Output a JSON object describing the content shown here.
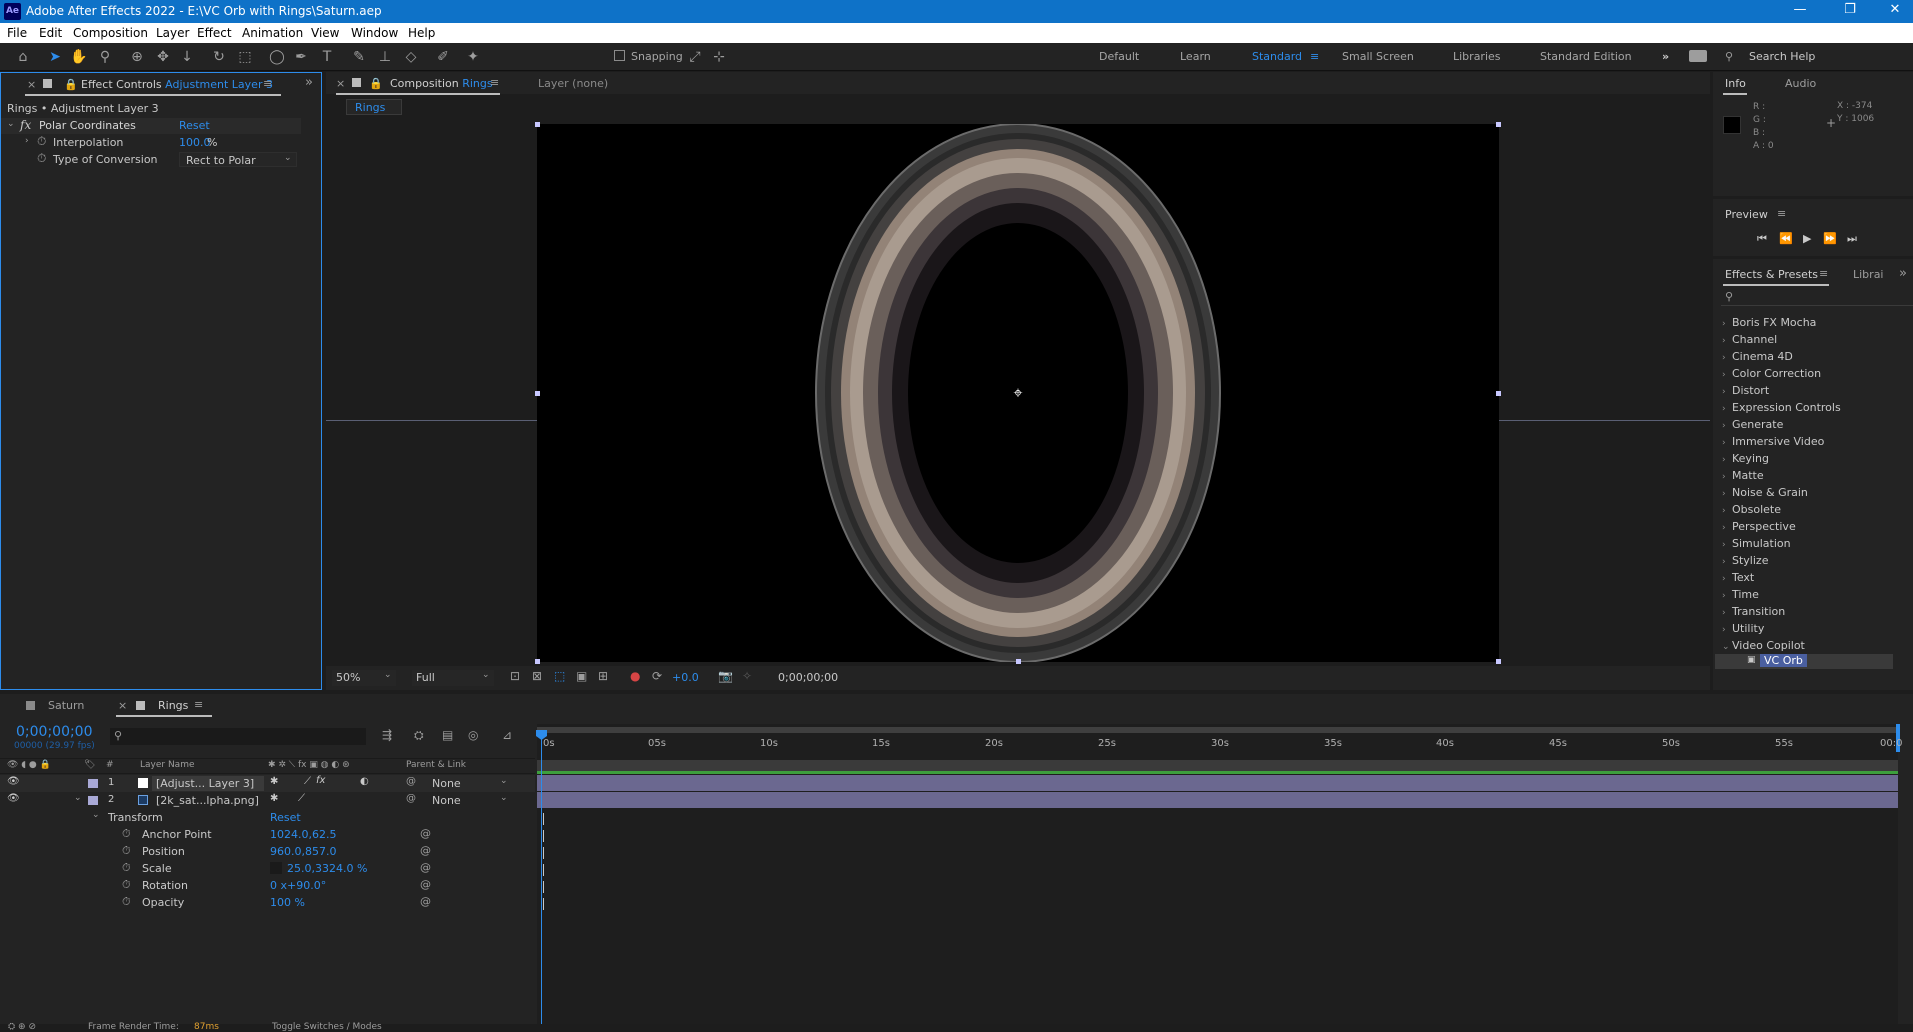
{
  "app": {
    "logo": "Ae",
    "title": "Adobe After Effects 2022 - E:\\VC Orb with Rings\\Saturn.aep",
    "window_controls": [
      "—",
      "❐",
      "✕"
    ]
  },
  "menu": [
    "File",
    "Edit",
    "Composition",
    "Layer",
    "Effect",
    "Animation",
    "View",
    "Window",
    "Help"
  ],
  "toolbar": {
    "snapping_label": "Snapping",
    "workspaces": [
      "Default",
      "Learn",
      "Standard",
      "Small Screen",
      "Libraries",
      "Standard Edition"
    ],
    "active_workspace": "Standard",
    "search_help": "Search Help"
  },
  "effect_controls": {
    "tab_prefix": "Effect Controls",
    "tab_layer": "Adjustment Layer 3",
    "header": "Rings • Adjustment Layer 3",
    "effect_name": "Polar Coordinates",
    "reset": "Reset",
    "props": [
      {
        "name": "Interpolation",
        "value": "100.0",
        "unit": "%"
      },
      {
        "name": "Type of Conversion",
        "value": "Rect to Polar"
      }
    ]
  },
  "composition": {
    "tab_prefix": "Composition",
    "tab_name": "Rings",
    "layer_tab": "Layer (none)",
    "breadcrumb": "Rings",
    "zoom": "50%",
    "resolution": "Full",
    "exposure": "+0.0",
    "timecode": "0;00;00;00"
  },
  "info": {
    "tab_info": "Info",
    "tab_audio": "Audio",
    "channels": [
      "R :",
      "G :",
      "B :",
      "A : 0"
    ],
    "x": "X : -374",
    "y": "Y : 1006"
  },
  "preview": {
    "title": "Preview"
  },
  "effects_presets": {
    "tab": "Effects & Presets",
    "tab2": "Librai",
    "categories": [
      "Boris FX Mocha",
      "Channel",
      "Cinema 4D",
      "Color Correction",
      "Distort",
      "Expression Controls",
      "Generate",
      "Immersive Video",
      "Keying",
      "Matte",
      "Noise & Grain",
      "Obsolete",
      "Perspective",
      "Simulation",
      "Stylize",
      "Text",
      "Time",
      "Transition",
      "Utility",
      "Video Copilot"
    ],
    "expanded": "Video Copilot",
    "child": "VC Orb"
  },
  "timeline": {
    "tabs": [
      "Saturn",
      "Rings"
    ],
    "active_tab": "Rings",
    "timecode": "0;00;00;00",
    "fps": "00000 (29.97 fps)",
    "col_num": "#",
    "col_layer_name": "Layer Name",
    "col_parent": "Parent & Link",
    "ruler": [
      "0s",
      "05s",
      "10s",
      "15s",
      "20s",
      "25s",
      "30s",
      "35s",
      "40s",
      "45s",
      "50s",
      "55s",
      "00:0"
    ],
    "layers": [
      {
        "num": "1",
        "name": "[Adjust... Layer 3]",
        "parent": "None"
      },
      {
        "num": "2",
        "name": "[2k_sat...lpha.png]",
        "parent": "None"
      }
    ],
    "transform_label": "Transform",
    "transform_reset": "Reset",
    "transform_props": [
      {
        "name": "Anchor Point",
        "value": "1024.0,62.5"
      },
      {
        "name": "Position",
        "value": "960.0,857.0"
      },
      {
        "name": "Scale",
        "value": "25.0,3324.0 %"
      },
      {
        "name": "Rotation",
        "value": "0 x+90.0°"
      },
      {
        "name": "Opacity",
        "value": "100 %"
      }
    ],
    "footer_render": "Frame Render Time:",
    "footer_render_val": "87ms",
    "footer_toggle": "Toggle Switches / Modes"
  }
}
